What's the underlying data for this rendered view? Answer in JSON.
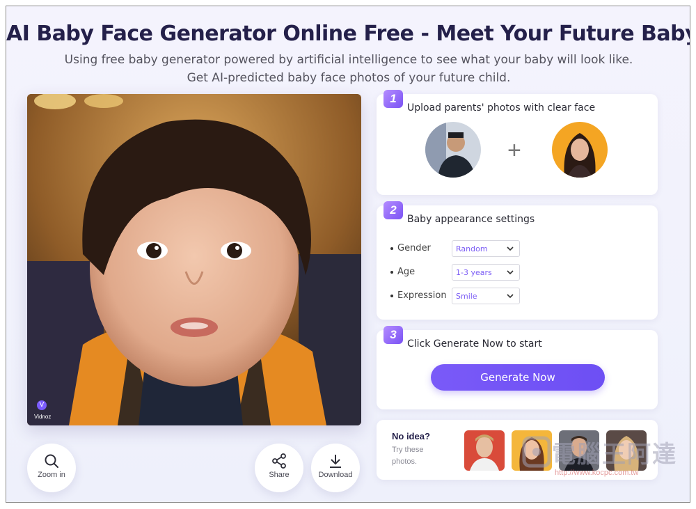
{
  "header": {
    "title": "AI Baby Face Generator Online Free - Meet Your Future Baby",
    "subtitle_line1": "Using free baby generator powered by artificial intelligence to see what your baby will look like.",
    "subtitle_line2": "Get AI-predicted baby face photos of your future child."
  },
  "preview": {
    "watermark": "Vidnoz",
    "actions": [
      {
        "label": "Zoom in",
        "icon": "search-icon"
      },
      {
        "label": "Share",
        "icon": "share-icon"
      },
      {
        "label": "Download",
        "icon": "download-icon"
      }
    ]
  },
  "step1": {
    "number": "1",
    "title": "Upload parents' photos with clear face"
  },
  "step2": {
    "number": "2",
    "title": "Baby appearance settings",
    "settings": [
      {
        "label": "Gender",
        "value": "Random"
      },
      {
        "label": "Age",
        "value": "1-3 years"
      },
      {
        "label": "Expression",
        "value": "Smile"
      }
    ]
  },
  "step3": {
    "number": "3",
    "title": "Click Generate Now to start",
    "button": "Generate Now"
  },
  "suggestions": {
    "title": "No idea?",
    "subtitle": "Try these photos."
  },
  "watermark": {
    "chinese": "電腦王阿達",
    "url": "http://www.kocpc.com.tw"
  },
  "colors": {
    "accent": "#7a5af8",
    "title": "#24204a",
    "background": "#f2f2fc"
  }
}
